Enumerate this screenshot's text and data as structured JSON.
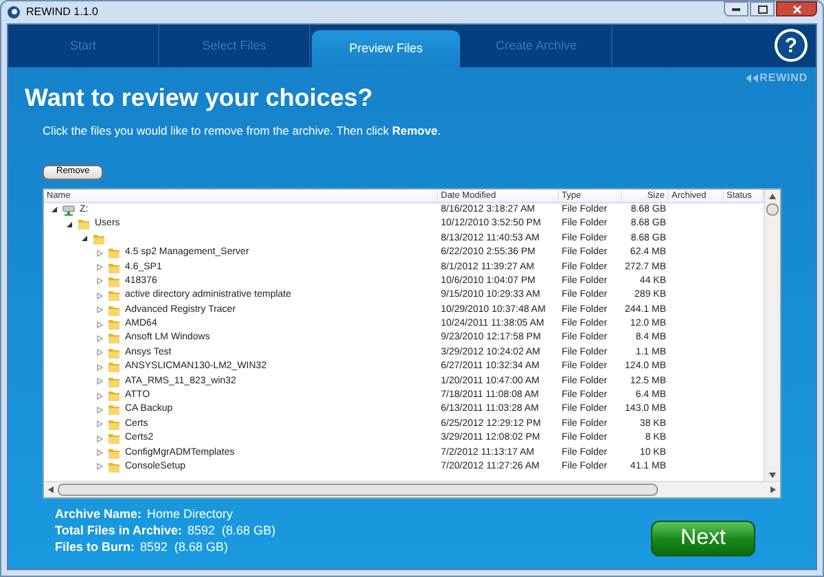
{
  "window": {
    "title": "REWIND 1.1.0"
  },
  "tabs": [
    {
      "label": "Start",
      "selected": false
    },
    {
      "label": "Select Files",
      "selected": false
    },
    {
      "label": "Preview Files",
      "selected": true
    },
    {
      "label": "Create Archive",
      "selected": false
    }
  ],
  "help": {
    "label": "?"
  },
  "brand": "REWIND",
  "heading": "Want to review your choices?",
  "instruction": "Click the files you would like to remove from the archive. Then click **Remove**.",
  "remove_button": "Remove",
  "table": {
    "columns": [
      "Name",
      "Date Modified",
      "Type",
      "Size",
      "Archived",
      "Status"
    ],
    "rows": [
      {
        "kind": "drive",
        "name": "Z:",
        "date": "8/16/2012 3:18:27 AM",
        "type": "File Folder",
        "size": "8.68 GB",
        "expanded": true,
        "children": [
          {
            "kind": "folder",
            "name": "Users",
            "date": "10/12/2010 3:52:50 PM",
            "type": "File Folder",
            "size": "8.68 GB",
            "expanded": true,
            "children": [
              {
                "kind": "folder",
                "date": "8/13/2012 11:40:53 AM",
                "type": "File Folder",
                "size": "8.68 GB",
                "expanded": true,
                "children": [
                  {
                    "kind": "folder",
                    "name": "4.5 sp2 Management_Server",
                    "date": "6/22/2010 2:55:36 PM",
                    "type": "File Folder",
                    "size": "62.4 MB",
                    "expanded": false
                  },
                  {
                    "kind": "folder",
                    "name": "4.6_SP1",
                    "date": "8/1/2012 11:39:27 AM",
                    "type": "File Folder",
                    "size": "272.7 MB",
                    "expanded": false
                  },
                  {
                    "kind": "folder",
                    "name": "418376",
                    "date": "10/6/2010 1:04:07 PM",
                    "type": "File Folder",
                    "size": "44 KB",
                    "expanded": false
                  },
                  {
                    "kind": "folder",
                    "name": "active directory administrative template",
                    "date": "9/15/2010 10:29:33 AM",
                    "type": "File Folder",
                    "size": "289 KB",
                    "expanded": false
                  },
                  {
                    "kind": "folder",
                    "name": "Advanced Registry Tracer",
                    "date": "10/29/2010 10:37:48 AM",
                    "type": "File Folder",
                    "size": "244.1 MB",
                    "expanded": false
                  },
                  {
                    "kind": "folder",
                    "name": "AMD64",
                    "date": "10/24/2011 11:38:05 AM",
                    "type": "File Folder",
                    "size": "12.0 MB",
                    "expanded": false
                  },
                  {
                    "kind": "folder",
                    "name": "Ansoft LM Windows",
                    "date": "9/23/2010 12:17:58 PM",
                    "type": "File Folder",
                    "size": "8.4 MB",
                    "expanded": false
                  },
                  {
                    "kind": "folder",
                    "name": "Ansys Test",
                    "date": "3/29/2012 10:24:02 AM",
                    "type": "File Folder",
                    "size": "1.1 MB",
                    "expanded": false
                  },
                  {
                    "kind": "folder",
                    "name": "ANSYSLICMAN130-LM2_WIN32",
                    "date": "6/27/2011 10:32:34 AM",
                    "type": "File Folder",
                    "size": "124.0 MB",
                    "expanded": false
                  },
                  {
                    "kind": "folder",
                    "name": "ATA_RMS_11_823_win32",
                    "date": "1/20/2011 10:47:00 AM",
                    "type": "File Folder",
                    "size": "12.5 MB",
                    "expanded": false
                  },
                  {
                    "kind": "folder",
                    "name": "ATTO",
                    "date": "7/18/2011 11:08:08 AM",
                    "type": "File Folder",
                    "size": "6.4 MB",
                    "expanded": false
                  },
                  {
                    "kind": "folder",
                    "name": "CA Backup",
                    "date": "6/13/2011 11:03:28 AM",
                    "type": "File Folder",
                    "size": "143.0 MB",
                    "expanded": false
                  },
                  {
                    "kind": "folder",
                    "name": "Certs",
                    "date": "6/25/2012 12:29:12 PM",
                    "type": "File Folder",
                    "size": "38 KB",
                    "expanded": false
                  },
                  {
                    "kind": "folder",
                    "name": "Certs2",
                    "date": "3/29/2011 12:08:02 PM",
                    "type": "File Folder",
                    "size": "8 KB",
                    "expanded": false
                  },
                  {
                    "kind": "folder",
                    "name": "ConfigMgrADMTemplates",
                    "date": "7/2/2012 11:13:17 AM",
                    "type": "File Folder",
                    "size": "10 KB",
                    "expanded": false
                  },
                  {
                    "kind": "folder",
                    "name": "ConsoleSetup",
                    "date": "7/20/2012 11:27:26 AM",
                    "type": "File Folder",
                    "size": "41.1 MB",
                    "expanded": false
                  }
                ]
              }
            ]
          }
        ]
      }
    ]
  },
  "summary": [
    {
      "label": "Archive Name:",
      "value": "Home Directory"
    },
    {
      "label": "Total Files in Archive:",
      "value": "8592  (8.68 GB)"
    },
    {
      "label": "Files to Burn:",
      "value": "8592  (8.68 GB)"
    }
  ],
  "next_button": "Next"
}
